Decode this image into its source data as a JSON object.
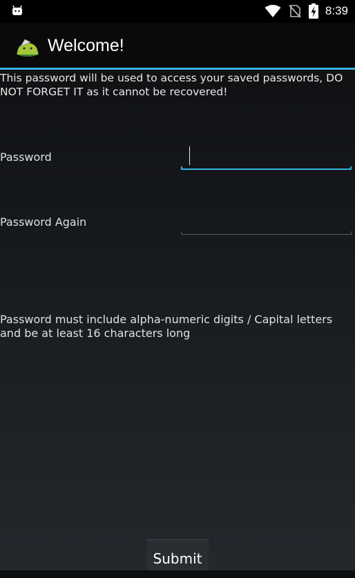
{
  "status_bar": {
    "time": "8:39",
    "icons": [
      "android-notification-icon",
      "wifi-icon",
      "no-sim-icon",
      "battery-charging-icon"
    ]
  },
  "action_bar": {
    "title": "Welcome!",
    "app_icon": "android-app-icon"
  },
  "form": {
    "message": "This password will be used to access your saved passwords, DO NOT FORGET IT as it cannot be recovered!",
    "password_label": "Password",
    "password_value": "",
    "password_again_label": "Password Again",
    "password_again_value": "",
    "hint": "Password must include alpha-numeric digits / Capital letters and be at least 16 characters long",
    "submit_label": "Submit"
  },
  "colors": {
    "accent": "#33b5e5",
    "status_bar": "#000000",
    "action_bar": "#0a0a0b"
  }
}
